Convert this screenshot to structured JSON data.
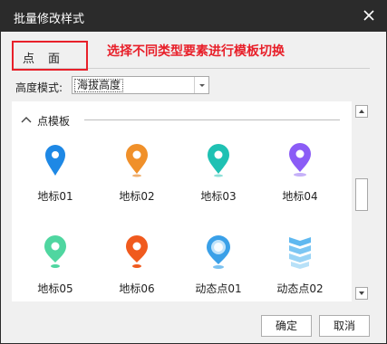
{
  "window": {
    "title": "批量修改样式"
  },
  "tabs": [
    {
      "label": "点"
    },
    {
      "label": "面"
    }
  ],
  "annotation": "选择不同类型要素进行模板切换",
  "height_mode": {
    "label": "高度模式:",
    "value": "海拔高度"
  },
  "group": {
    "label": "点模板"
  },
  "templates": [
    {
      "label": "地标01",
      "icon": "blue-map-pin",
      "color": "#1e88e5"
    },
    {
      "label": "地标02",
      "icon": "orange-map-pin",
      "color": "#f0902a"
    },
    {
      "label": "地标03",
      "icon": "teal-map-pin",
      "color": "#1fc1b3"
    },
    {
      "label": "地标04",
      "icon": "purple-map-pin",
      "color": "#8b5cf6"
    },
    {
      "label": "地标05",
      "icon": "green-map-pin",
      "color": "#4fd6a0"
    },
    {
      "label": "地标06",
      "icon": "red-orange-map-pin",
      "color": "#f05a1e"
    },
    {
      "label": "动态点01",
      "icon": "blue-bubble-pin",
      "color": "#3aa0e8"
    },
    {
      "label": "动态点02",
      "icon": "blue-stack-layers",
      "color": "#5fb8f0"
    }
  ],
  "buttons": {
    "ok": "确定",
    "cancel": "取消"
  },
  "colors": {
    "titlebar": "#2b2b2b",
    "annotation": "#e8202a"
  }
}
